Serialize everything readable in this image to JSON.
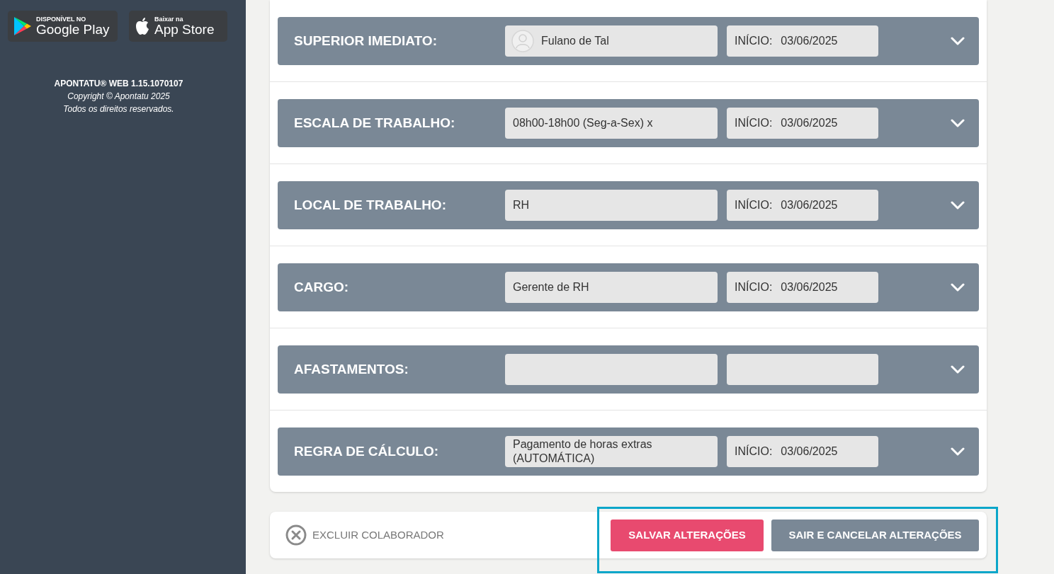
{
  "sidebar": {
    "store_badges": [
      {
        "kind": "google",
        "small": "DISPONÍVEL NO",
        "big": "Google Play"
      },
      {
        "kind": "apple",
        "small": "Baixar na",
        "big": "App Store"
      }
    ],
    "version": "APONTATU® WEB 1.15.1070107",
    "copyright": "Copyright © Apontatu 2025",
    "rights": "Todos os direitos reservados."
  },
  "sections": [
    {
      "label": "SUPERIOR IMEDIATO:",
      "avatar": true,
      "value": "Fulano de Tal",
      "start_label": "INÍCIO:",
      "start_date": "03/06/2025"
    },
    {
      "label": "ESCALA DE TRABALHO:",
      "avatar": false,
      "value": "08h00-18h00 (Seg-a-Sex) x",
      "start_label": "INÍCIO:",
      "start_date": "03/06/2025"
    },
    {
      "label": "LOCAL DE TRABALHO:",
      "avatar": false,
      "value": "RH",
      "start_label": "INÍCIO:",
      "start_date": "03/06/2025"
    },
    {
      "label": "CARGO:",
      "avatar": false,
      "value": "Gerente de RH",
      "start_label": "INÍCIO:",
      "start_date": "03/06/2025"
    },
    {
      "label": "AFASTAMENTOS:",
      "avatar": false
    },
    {
      "label": "REGRA DE CÁLCULO:",
      "avatar": false,
      "value": "Pagamento de horas extras\n(AUTOMÁTICA)",
      "start_label": "INÍCIO:",
      "start_date": "03/06/2025"
    }
  ],
  "footer": {
    "delete_label": "EXCLUIR COLABORADOR",
    "save_button": "SALVAR ALTERAÇÕES",
    "cancel_button": "SAIR E CANCELAR ALTERAÇÕES",
    "highlighted": true
  }
}
